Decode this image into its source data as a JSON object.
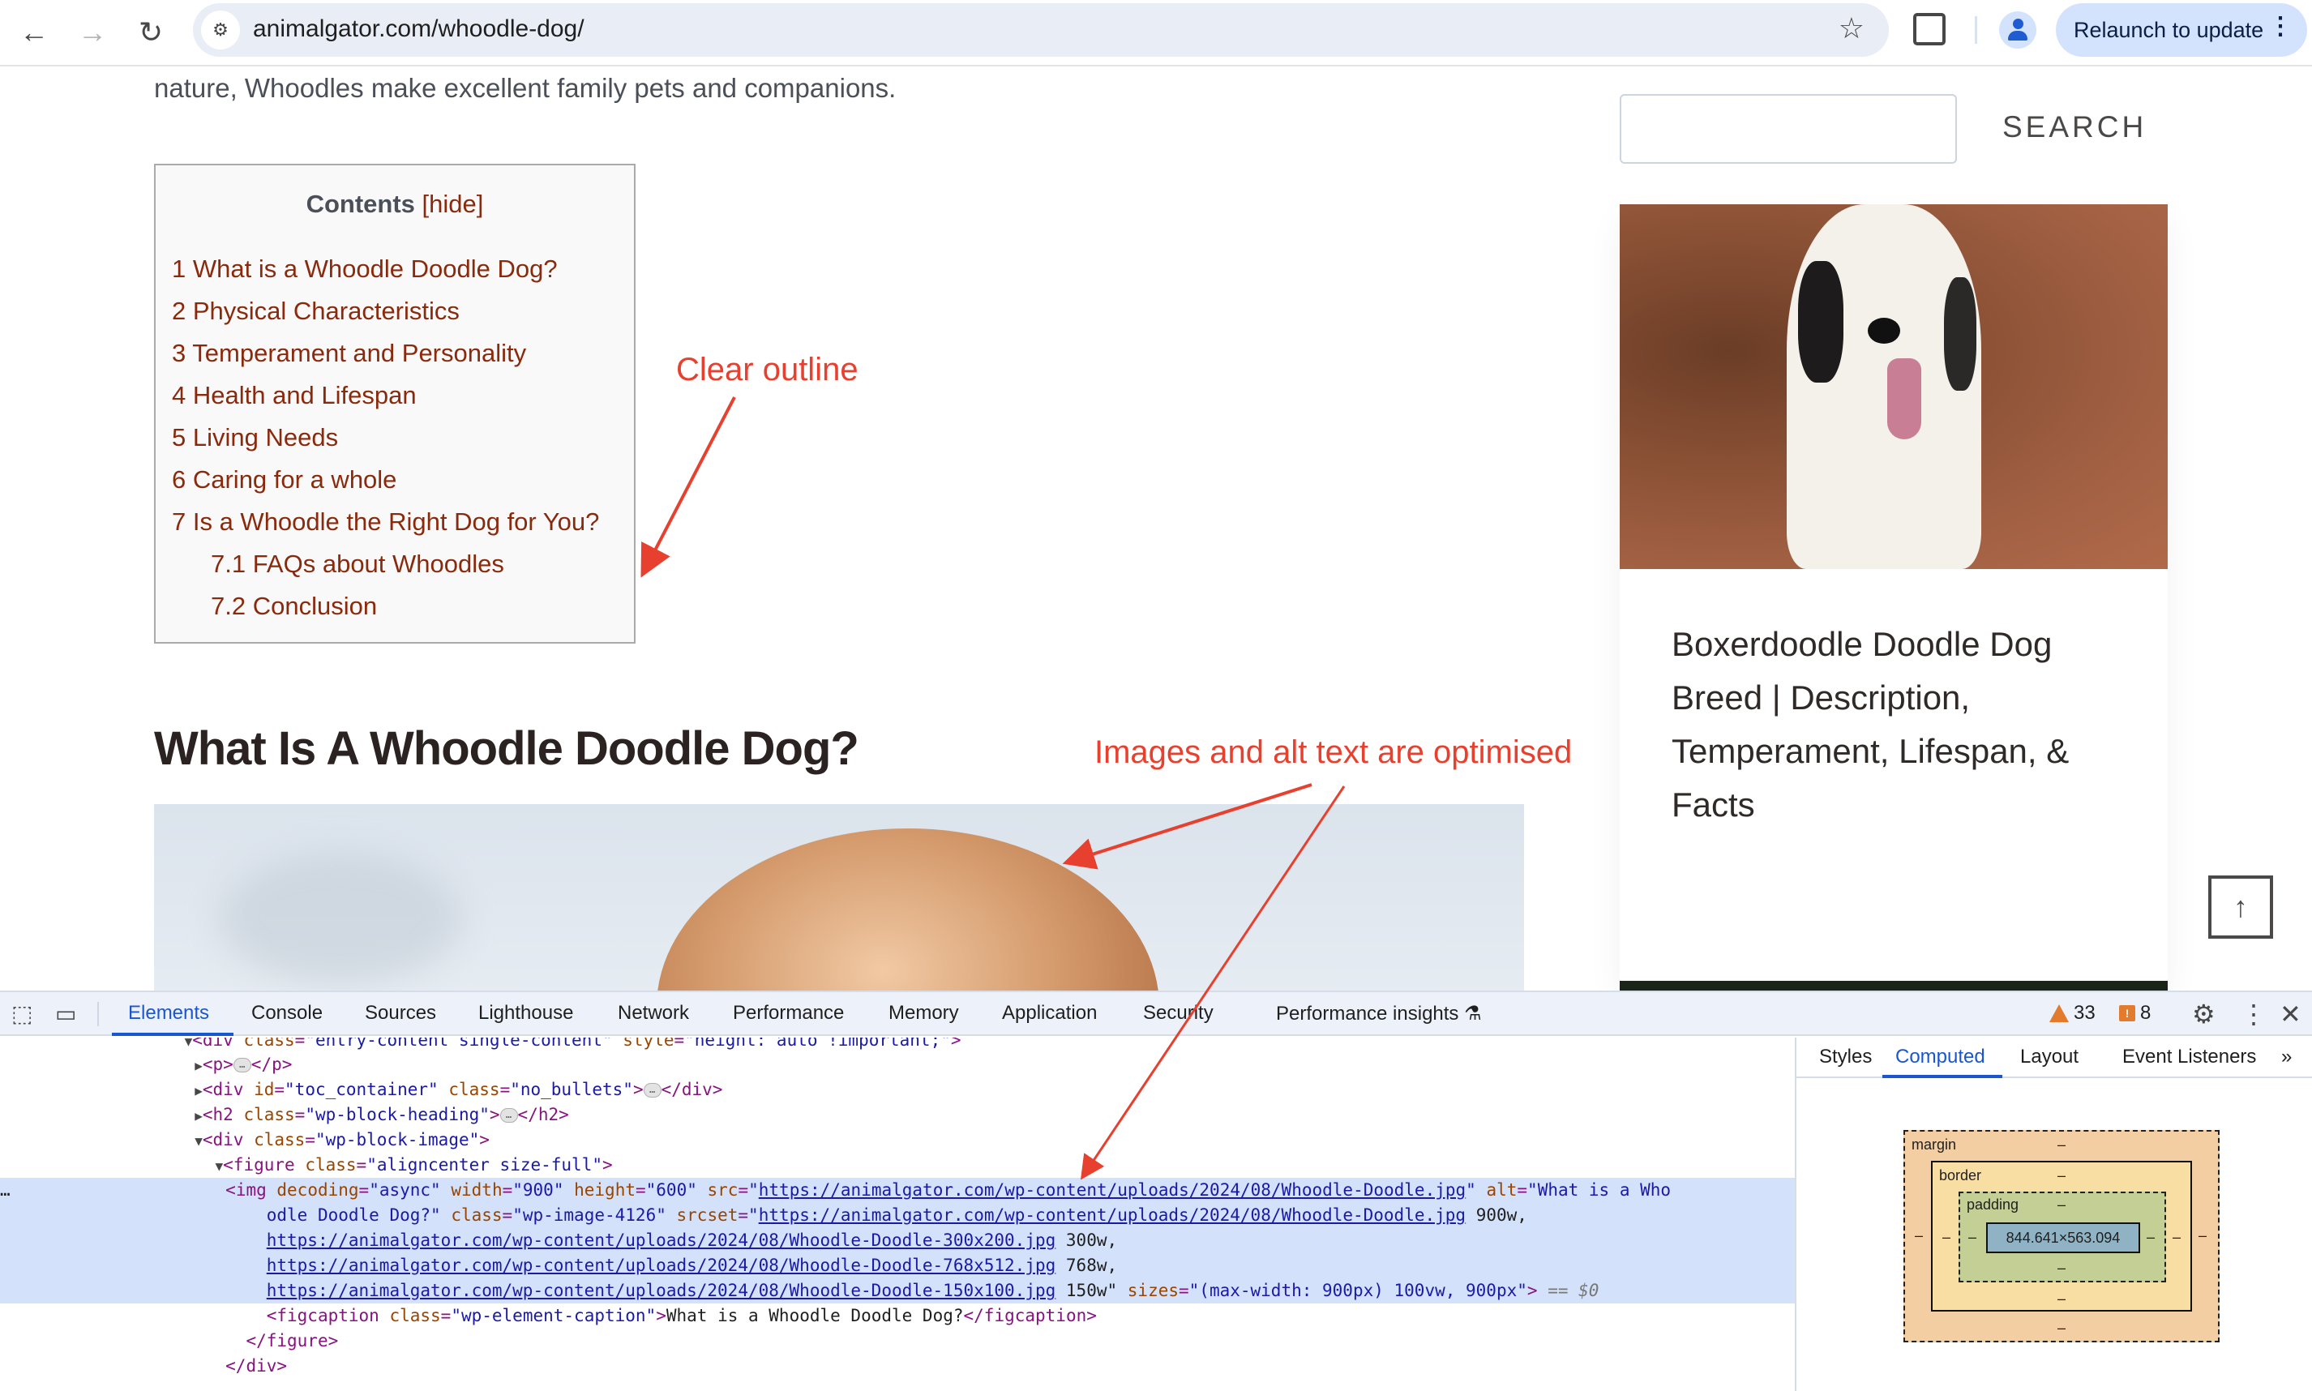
{
  "browser": {
    "back_icon": "arrow-left",
    "forward_icon": "arrow-right",
    "reload_icon": "reload",
    "url": "animalgator.com/whoodle-dog/",
    "relaunch_label": "Relaunch to update"
  },
  "page": {
    "intro_text": "nature, Whoodles make excellent family pets and companions.",
    "toc": {
      "title": "Contents",
      "hide_label": "[hide]",
      "items": [
        {
          "label": "1 What is a Whoodle Doodle Dog?",
          "level": 1
        },
        {
          "label": "2 Physical Characteristics",
          "level": 1
        },
        {
          "label": "3 Temperament and Personality",
          "level": 1
        },
        {
          "label": "4 Health and Lifespan",
          "level": 1
        },
        {
          "label": "5 Living Needs",
          "level": 1
        },
        {
          "label": "6 Caring for a whole",
          "level": 1
        },
        {
          "label": "7 Is a Whoodle the Right Dog for You?",
          "level": 1
        },
        {
          "label": "7.1 FAQs about Whoodles",
          "level": 2
        },
        {
          "label": "7.2 Conclusion",
          "level": 2
        }
      ]
    },
    "heading": "What Is A Whoodle Doodle Dog?",
    "sidebar": {
      "search_placeholder": "",
      "search_button": "SEARCH",
      "card_title": "Boxerdoodle Doodle Dog Breed | Description, Temperament, Lifespan, & Facts",
      "scroll_top_icon": "arrow-up"
    }
  },
  "annotations": {
    "toc_note": "Clear outline",
    "image_note": "Images and alt text are optimised",
    "color": "#e8402f"
  },
  "devtools": {
    "tabs": [
      "Elements",
      "Console",
      "Sources",
      "Lighthouse",
      "Network",
      "Performance",
      "Memory",
      "Application",
      "Security",
      "Performance insights"
    ],
    "active_tab": "Elements",
    "warnings_count": "33",
    "issues_count": "8",
    "dom_lines": {
      "l0": {
        "tag_open": "<div ",
        "a1": "class",
        "v1": "\"entry-content single-content\"",
        "a2": "style",
        "v2": "\"height: auto !important;\"",
        "close": ">"
      },
      "l1": {
        "open": "<p>",
        "close": "</p>"
      },
      "l2": {
        "open": "<div ",
        "a1": "id",
        "v1": "\"toc_container\"",
        "a2": "class",
        "v2": "\"no_bullets\"",
        "close": "</div>"
      },
      "l3": {
        "open": "<h2 ",
        "a1": "class",
        "v1": "\"wp-block-heading\"",
        "close": "</h2>"
      },
      "l4": {
        "open": "<div ",
        "a1": "class",
        "v1": "\"wp-block-image\"",
        "end": ">"
      },
      "l5": {
        "open": "<figure ",
        "a1": "class",
        "v1": "\"aligncenter size-full\"",
        "end": ">"
      },
      "img": {
        "tag": "<img ",
        "decoding": "\"async\"",
        "width": "\"900\"",
        "height": "\"600\"",
        "src": "https://animalgator.com/wp-content/uploads/2024/08/Whoodle-Doodle.jpg",
        "alt_part1": "\"What is a Who",
        "alt_part2": "odle Doodle Dog?\"",
        "class": "\"wp-image-4126\"",
        "srcset": [
          {
            "url": "https://animalgator.com/wp-content/uploads/2024/08/Whoodle-Doodle.jpg",
            "w": " 900w,"
          },
          {
            "url": "https://animalgator.com/wp-content/uploads/2024/08/Whoodle-Doodle-300x200.jpg",
            "w": " 300w,"
          },
          {
            "url": "https://animalgator.com/wp-content/uploads/2024/08/Whoodle-Doodle-768x512.jpg",
            "w": " 768w,"
          },
          {
            "url": "https://animalgator.com/wp-content/uploads/2024/08/Whoodle-Doodle-150x100.jpg",
            "w": " 150w\""
          }
        ],
        "sizes": "\"(max-width: 900px) 100vw, 900px\"",
        "selected_marker": "== $0"
      },
      "figcaption": {
        "open": "<figcaption ",
        "a1": "class",
        "v1": "\"wp-element-caption\"",
        "text": "What is a Whoodle Doodle Dog?",
        "close": "</figcaption>"
      },
      "figure_close": "</figure>",
      "div_close": "</div>"
    },
    "side_tabs": [
      "Styles",
      "Computed",
      "Layout",
      "Event Listeners"
    ],
    "active_side_tab": "Computed",
    "box_model": {
      "margin_label": "margin",
      "border_label": "border",
      "padding_label": "padding",
      "content_size": "844.641×563.094",
      "empty_value": "–"
    }
  }
}
